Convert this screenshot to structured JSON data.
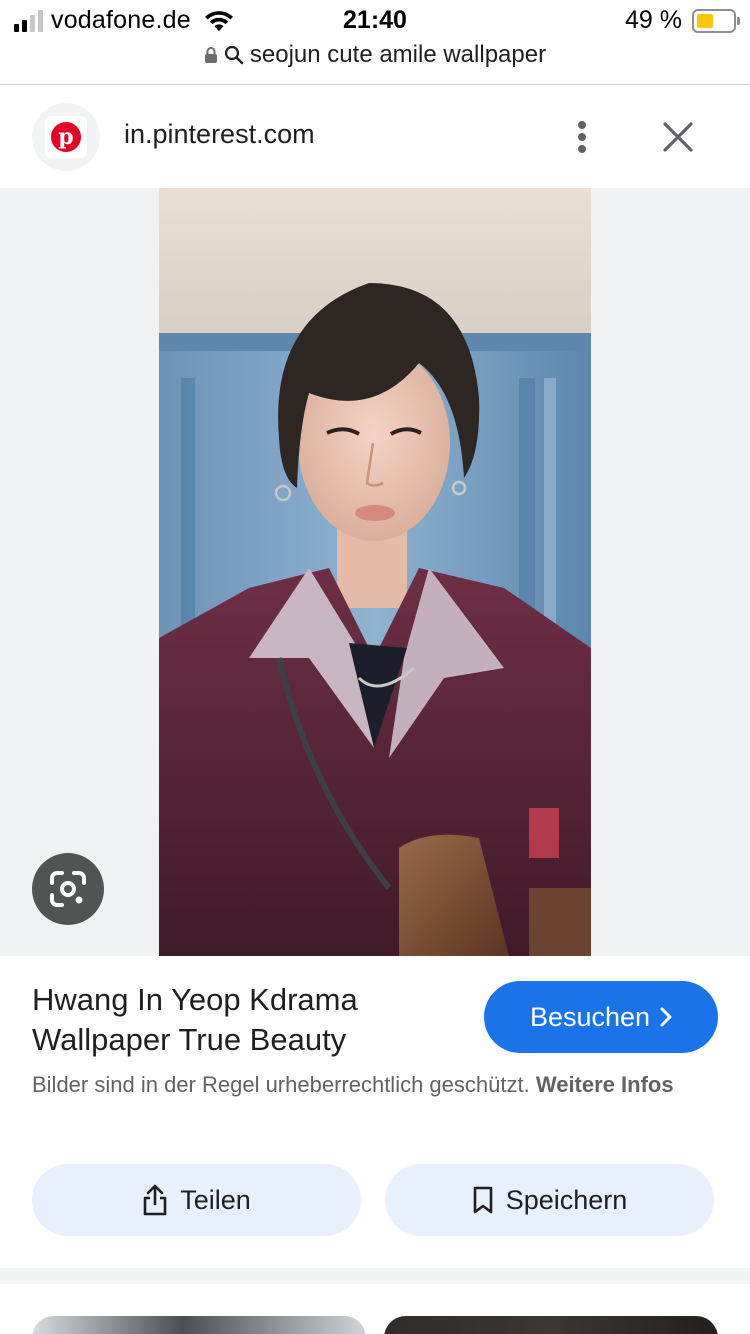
{
  "status_bar": {
    "carrier": "vodafone.de",
    "time": "21:40",
    "battery_percent": "49 %",
    "battery_level": 0.49,
    "battery_color": "#ffc60a"
  },
  "url_bar": {
    "text": "seojun cute amile wallpaper",
    "lock_icon": "lock-icon",
    "search_icon": "search-icon"
  },
  "source": {
    "favicon": "pinterest-logo",
    "brand_color": "#e60023",
    "domain": "in.pinterest.com",
    "more_icon": "more-vert-icon",
    "close_icon": "close-icon"
  },
  "image": {
    "lens_icon": "google-lens-icon"
  },
  "details": {
    "title": "Hwang In Yeop Kdrama Wallpaper True Beauty",
    "visit_label": "Besuchen",
    "visit_color": "#1a73e8",
    "copyright_text": "Bilder sind in der Regel urheberrechtlich geschützt.",
    "copyright_link": "Weitere Infos"
  },
  "actions": {
    "share_label": "Teilen",
    "save_label": "Speichern"
  }
}
